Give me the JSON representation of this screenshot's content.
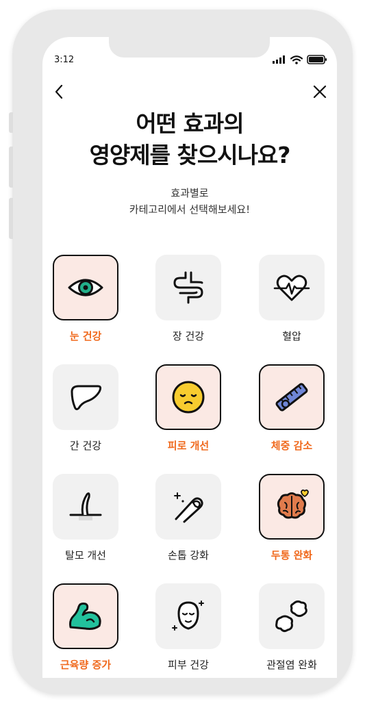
{
  "status": {
    "time": "3:12"
  },
  "nav": {
    "back_icon": "chevron-left-icon",
    "close_icon": "close-icon"
  },
  "header": {
    "title_line1": "어떤 효과의",
    "title_line2": "영양제를 찾으시나요?",
    "subtitle_line1": "효과별로",
    "subtitle_line2": "카테고리에서 선택해보세요!"
  },
  "categories": [
    {
      "label": "눈 건강",
      "icon": "eye-icon",
      "selected": true
    },
    {
      "label": "장 건강",
      "icon": "intestine-icon",
      "selected": false
    },
    {
      "label": "혈압",
      "icon": "heartbeat-icon",
      "selected": false
    },
    {
      "label": "간 건강",
      "icon": "liver-icon",
      "selected": false
    },
    {
      "label": "피로 개선",
      "icon": "tired-face-icon",
      "selected": true
    },
    {
      "label": "체중 감소",
      "icon": "tape-measure-icon",
      "selected": true
    },
    {
      "label": "탈모 개선",
      "icon": "hair-icon",
      "selected": false
    },
    {
      "label": "손톱 강화",
      "icon": "nail-icon",
      "selected": false
    },
    {
      "label": "두통 완화",
      "icon": "brain-icon",
      "selected": true
    },
    {
      "label": "근육량 증가",
      "icon": "muscle-arm-icon",
      "selected": true
    },
    {
      "label": "피부 건강",
      "icon": "face-icon",
      "selected": false
    },
    {
      "label": "관절염 완화",
      "icon": "joint-bone-icon",
      "selected": false
    }
  ],
  "colors": {
    "accent": "#f06a1e",
    "selected_tile": "#fbe9e4",
    "tile": "#f1f1f1"
  }
}
